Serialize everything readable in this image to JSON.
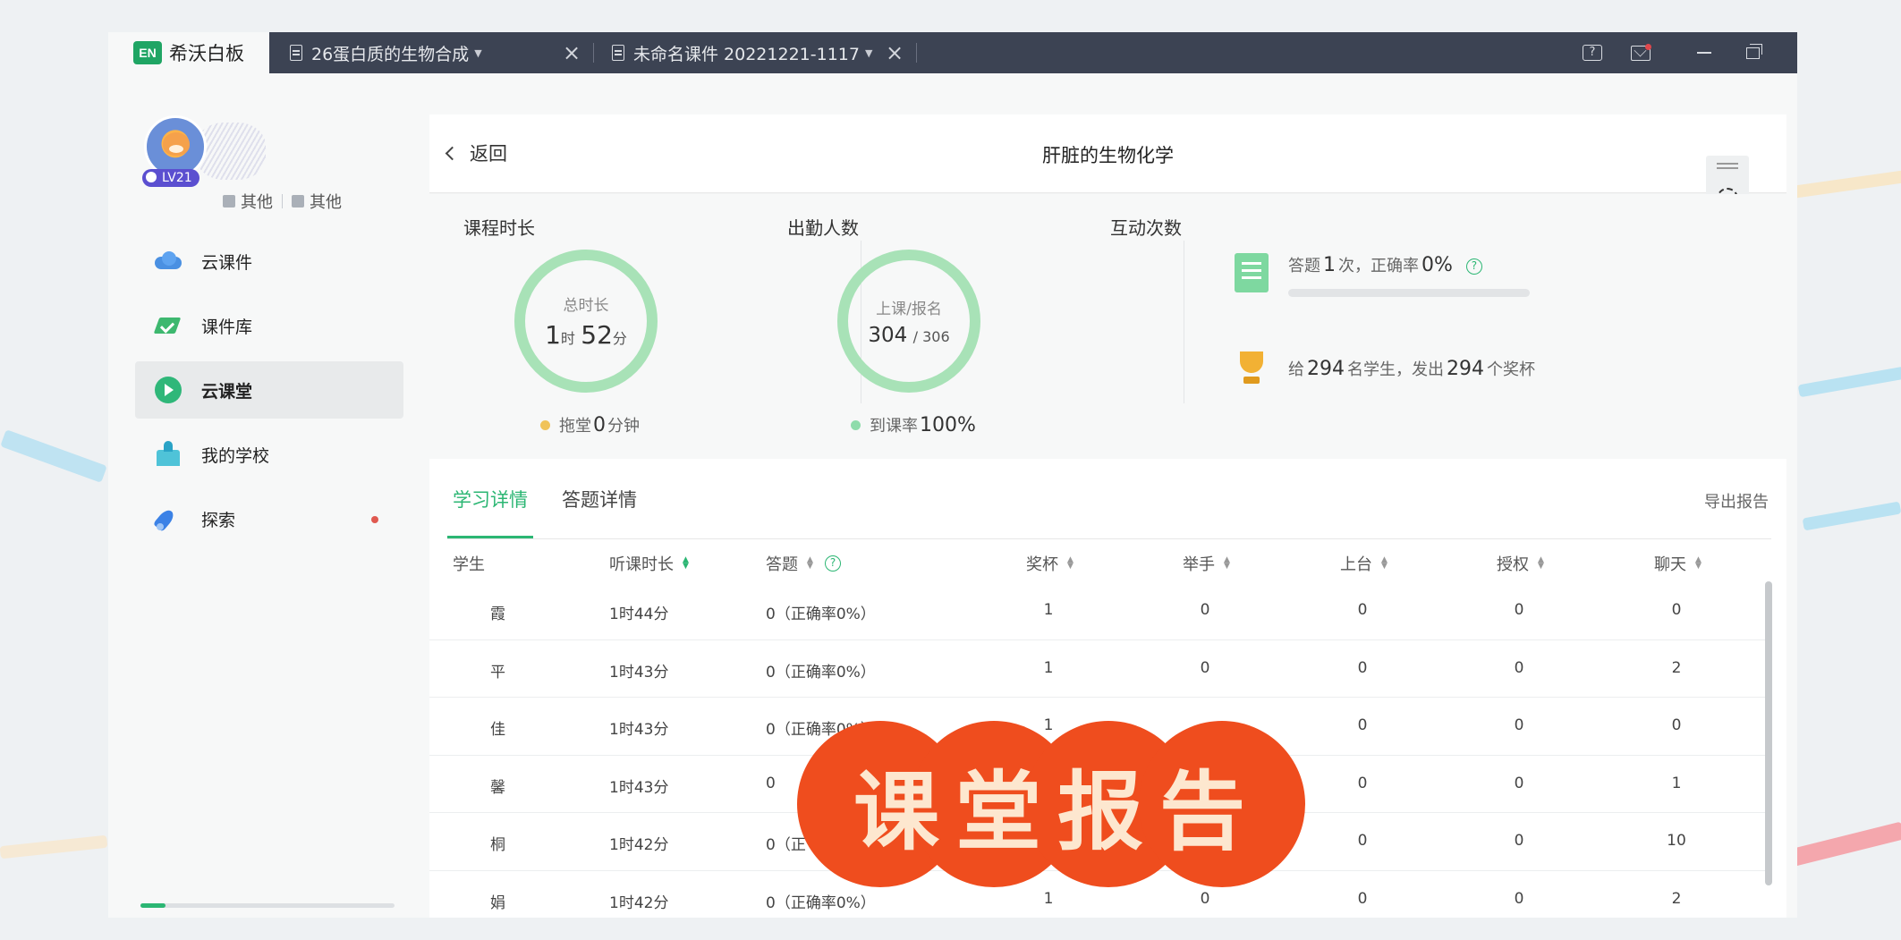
{
  "app": {
    "name": "希沃白板",
    "logo_text": "EN",
    "tabs": [
      {
        "label": "26蛋白质的生物合成"
      },
      {
        "label": "未命名课件 20221221-1117"
      }
    ]
  },
  "user": {
    "level": "LV21",
    "meta1": "其他",
    "meta2": "其他"
  },
  "sidebar": {
    "items": [
      {
        "label": "云课件",
        "icon": "cloud-icon"
      },
      {
        "label": "课件库",
        "icon": "courseware-library-icon"
      },
      {
        "label": "云课堂",
        "icon": "cloud-class-icon"
      },
      {
        "label": "我的学校",
        "icon": "school-icon"
      },
      {
        "label": "探索",
        "icon": "rocket-icon"
      }
    ],
    "progress_fraction": 0.1
  },
  "header": {
    "back_label": "返回",
    "title": "肝脏的生物化学"
  },
  "stats": {
    "duration": {
      "label": "课程时长",
      "caption": "总时长",
      "hours": "1",
      "hour_unit": "时",
      "minutes": "52",
      "minute_unit": "分",
      "foot_prefix": "拖堂",
      "foot_value": "0",
      "foot_suffix": "分钟"
    },
    "attendance": {
      "label": "出勤人数",
      "caption": "上课/报名",
      "present": "304",
      "total": "/ 306",
      "foot_prefix": "到课率",
      "foot_value": "100%"
    },
    "interaction": {
      "label": "互动次数",
      "answer_prefix": "答题",
      "answer_count": "1",
      "answer_mid": "次，正确率",
      "accuracy": "0%",
      "accuracy_fraction": 0.0,
      "award_prefix": "给",
      "award_students": "294",
      "award_mid": "名学生，发出",
      "award_cups": "294",
      "award_suffix": "个奖杯"
    }
  },
  "detail_tabs": {
    "study": "学习详情",
    "answer": "答题详情",
    "export": "导出报告"
  },
  "table": {
    "headers": {
      "student": "学生",
      "duration": "听课时长",
      "answer": "答题",
      "cup": "奖杯",
      "hand": "举手",
      "stage": "上台",
      "auth": "授权",
      "chat": "聊天"
    },
    "rows": [
      {
        "student": "霞",
        "duration": "1时44分",
        "answer": "0（正确率0%）",
        "cup": "1",
        "hand": "0",
        "stage": "0",
        "auth": "0",
        "chat": "0"
      },
      {
        "student": "平",
        "duration": "1时43分",
        "answer": "0（正确率0%）",
        "cup": "1",
        "hand": "0",
        "stage": "0",
        "auth": "0",
        "chat": "2"
      },
      {
        "student": "佳",
        "duration": "1时43分",
        "answer": "0（正确率0%）",
        "cup": "1",
        "hand": "",
        "stage": "0",
        "auth": "0",
        "chat": "0"
      },
      {
        "student": "馨",
        "duration": "1时43分",
        "answer": "0",
        "cup": "",
        "hand": "",
        "stage": "0",
        "auth": "0",
        "chat": "1"
      },
      {
        "student": "桐",
        "duration": "1时42分",
        "answer": "0（正",
        "cup": "",
        "hand": "",
        "stage": "0",
        "auth": "0",
        "chat": "10"
      },
      {
        "student": "娟",
        "duration": "1时42分",
        "answer": "0（正确率0%）",
        "cup": "1",
        "hand": "0",
        "stage": "0",
        "auth": "0",
        "chat": "2"
      }
    ]
  },
  "overlay": {
    "text": "课堂报告"
  },
  "colors": {
    "accent": "#2bb673",
    "ring": "#a8e2b7",
    "titlebar": "#3c4353",
    "sticker": "#ef4d1e"
  }
}
